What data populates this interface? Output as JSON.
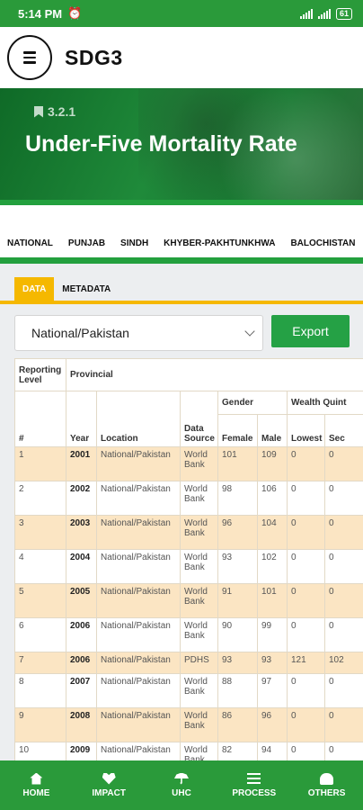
{
  "status_bar": {
    "time": "5:14 PM",
    "battery": "61"
  },
  "header": {
    "title": "SDG3"
  },
  "hero": {
    "code": "3.2.1",
    "title": "Under-Five Mortality Rate"
  },
  "region_tabs": [
    "NATIONAL",
    "PUNJAB",
    "SINDH",
    "KHYBER-PAKHTUNKHWA",
    "BALOCHISTAN"
  ],
  "sub_tabs": [
    "DATA",
    "METADATA"
  ],
  "filter": {
    "selected": "National/Pakistan",
    "export_label": "Export"
  },
  "table": {
    "header": {
      "reporting_level": "Reporting Level",
      "provincial": "Provincial",
      "gender": "Gender",
      "wealth": "Wealth Quint",
      "cols": [
        "#",
        "Year",
        "Location",
        "Data Source",
        "Female",
        "Male",
        "Lowest",
        "Sec"
      ]
    },
    "rows": [
      {
        "n": "1",
        "year": "2001",
        "location": "National/Pakistan",
        "source": "World Bank",
        "female": "101",
        "male": "109",
        "lowest": "0",
        "sec": "0"
      },
      {
        "n": "2",
        "year": "2002",
        "location": "National/Pakistan",
        "source": "World Bank",
        "female": "98",
        "male": "106",
        "lowest": "0",
        "sec": "0"
      },
      {
        "n": "3",
        "year": "2003",
        "location": "National/Pakistan",
        "source": "World Bank",
        "female": "96",
        "male": "104",
        "lowest": "0",
        "sec": "0"
      },
      {
        "n": "4",
        "year": "2004",
        "location": "National/Pakistan",
        "source": "World Bank",
        "female": "93",
        "male": "102",
        "lowest": "0",
        "sec": "0"
      },
      {
        "n": "5",
        "year": "2005",
        "location": "National/Pakistan",
        "source": "World Bank",
        "female": "91",
        "male": "101",
        "lowest": "0",
        "sec": "0"
      },
      {
        "n": "6",
        "year": "2006",
        "location": "National/Pakistan",
        "source": "World Bank",
        "female": "90",
        "male": "99",
        "lowest": "0",
        "sec": "0"
      },
      {
        "n": "7",
        "year": "2006",
        "location": "National/Pakistan",
        "source": "PDHS",
        "female": "93",
        "male": "93",
        "lowest": "121",
        "sec": "102"
      },
      {
        "n": "8",
        "year": "2007",
        "location": "National/Pakistan",
        "source": "World Bank",
        "female": "88",
        "male": "97",
        "lowest": "0",
        "sec": "0"
      },
      {
        "n": "9",
        "year": "2008",
        "location": "National/Pakistan",
        "source": "World Bank",
        "female": "86",
        "male": "96",
        "lowest": "0",
        "sec": "0"
      },
      {
        "n": "10",
        "year": "2009",
        "location": "National/Pakistan",
        "source": "World Bank",
        "female": "82",
        "male": "94",
        "lowest": "0",
        "sec": "0"
      }
    ]
  },
  "bottom_nav": [
    {
      "label": "HOME",
      "icon": "home-icon"
    },
    {
      "label": "IMPACT",
      "icon": "heart-icon"
    },
    {
      "label": "UHC",
      "icon": "umbrella-icon"
    },
    {
      "label": "PROCESS",
      "icon": "list-icon"
    },
    {
      "label": "OTHERS",
      "icon": "gauge-icon"
    }
  ],
  "colors": {
    "brand_green": "#2a9a3a",
    "accent_yellow": "#f5b800",
    "row_highlight": "#fbe5c3",
    "export_green": "#25a145"
  }
}
